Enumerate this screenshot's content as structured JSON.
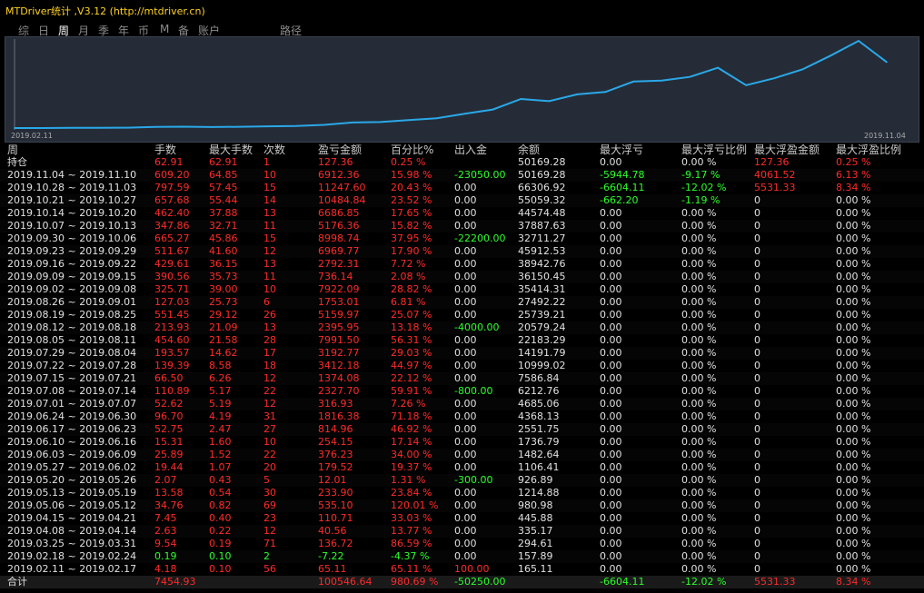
{
  "app": {
    "title": "MTDriver统计 ,V3.12 (http://mtdriver.cn)"
  },
  "tabs": [
    {
      "label": "综",
      "active": false
    },
    {
      "label": "日",
      "active": false
    },
    {
      "label": "周",
      "active": true
    },
    {
      "label": "月",
      "active": false
    },
    {
      "label": "季",
      "active": false
    },
    {
      "label": "年",
      "active": false
    },
    {
      "label": "币",
      "active": false
    },
    {
      "label": "M",
      "active": false
    },
    {
      "label": "备",
      "active": false
    },
    {
      "label": "账户",
      "active": false
    },
    {
      "label": "路径",
      "active": false
    }
  ],
  "colors": {
    "line": "#2aa8e8",
    "loss": "#ff2a2a",
    "gain": "#2aff2a",
    "neutral": "#e0e0e0",
    "title": "#ffd21e",
    "chart_bg": "#252c37"
  },
  "chart_data": {
    "type": "line",
    "x_start_label": "2019.02.11",
    "x_end_label": "2019.11.04",
    "series": [
      {
        "values": [
          165.11,
          157.89,
          294.61,
          335.17,
          445.88,
          980.98,
          1214.88,
          926.89,
          1106.41,
          1482.64,
          1736.79,
          2551.75,
          4368.13,
          4685.06,
          6212.76,
          7586.84,
          10999.02,
          14191.79,
          22183.29,
          20579.24,
          25739.21,
          27492.22,
          35414.31,
          36150.45,
          38942.76,
          45912.53,
          32711.27,
          37887.63,
          44574.48,
          55059.32,
          66306.92,
          50169.28
        ]
      }
    ]
  },
  "table": {
    "headers": [
      "周",
      "手数",
      "最大手数",
      "次数",
      "盈亏金额",
      "百分比%",
      "出入金",
      "余额",
      "最大浮亏",
      "最大浮亏比例",
      "最大浮盈金额",
      "最大浮盈比例"
    ],
    "rows": [
      [
        "持仓",
        "62.91",
        "62.91",
        "1",
        "127.36",
        "0.25 %",
        "",
        "50169.28",
        "0.00",
        "0.00 %",
        "127.36",
        "0.25 %"
      ],
      [
        "2019.11.04 ~ 2019.11.10",
        "609.20",
        "64.85",
        "10",
        "6912.36",
        "15.98 %",
        "-23050.00",
        "50169.28",
        "-5944.78",
        "-9.17 %",
        "4061.52",
        "6.13 %"
      ],
      [
        "2019.10.28 ~ 2019.11.03",
        "797.59",
        "57.45",
        "15",
        "11247.60",
        "20.43 %",
        "0.00",
        "66306.92",
        "-6604.11",
        "-12.02 %",
        "5531.33",
        "8.34 %"
      ],
      [
        "2019.10.21 ~ 2019.10.27",
        "657.68",
        "55.44",
        "14",
        "10484.84",
        "23.52 %",
        "0.00",
        "55059.32",
        "-662.20",
        "-1.19 %",
        "0",
        "0.00 %"
      ],
      [
        "2019.10.14 ~ 2019.10.20",
        "462.40",
        "37.88",
        "13",
        "6686.85",
        "17.65 %",
        "0.00",
        "44574.48",
        "0.00",
        "0.00 %",
        "0",
        "0.00 %"
      ],
      [
        "2019.10.07 ~ 2019.10.13",
        "347.86",
        "32.71",
        "11",
        "5176.36",
        "15.82 %",
        "0.00",
        "37887.63",
        "0.00",
        "0.00 %",
        "0",
        "0.00 %"
      ],
      [
        "2019.09.30 ~ 2019.10.06",
        "665.27",
        "45.86",
        "15",
        "8998.74",
        "37.95 %",
        "-22200.00",
        "32711.27",
        "0.00",
        "0.00 %",
        "0",
        "0.00 %"
      ],
      [
        "2019.09.23 ~ 2019.09.29",
        "511.67",
        "41.60",
        "12",
        "6969.77",
        "17.90 %",
        "0.00",
        "45912.53",
        "0.00",
        "0.00 %",
        "0",
        "0.00 %"
      ],
      [
        "2019.09.16 ~ 2019.09.22",
        "429.61",
        "36.15",
        "13",
        "2792.31",
        "7.72 %",
        "0.00",
        "38942.76",
        "0.00",
        "0.00 %",
        "0",
        "0.00 %"
      ],
      [
        "2019.09.09 ~ 2019.09.15",
        "390.56",
        "35.73",
        "11",
        "736.14",
        "2.08 %",
        "0.00",
        "36150.45",
        "0.00",
        "0.00 %",
        "0",
        "0.00 %"
      ],
      [
        "2019.09.02 ~ 2019.09.08",
        "325.71",
        "39.00",
        "10",
        "7922.09",
        "28.82 %",
        "0.00",
        "35414.31",
        "0.00",
        "0.00 %",
        "0",
        "0.00 %"
      ],
      [
        "2019.08.26 ~ 2019.09.01",
        "127.03",
        "25.73",
        "6",
        "1753.01",
        "6.81 %",
        "0.00",
        "27492.22",
        "0.00",
        "0.00 %",
        "0",
        "0.00 %"
      ],
      [
        "2019.08.19 ~ 2019.08.25",
        "551.45",
        "29.12",
        "26",
        "5159.97",
        "25.07 %",
        "0.00",
        "25739.21",
        "0.00",
        "0.00 %",
        "0",
        "0.00 %"
      ],
      [
        "2019.08.12 ~ 2019.08.18",
        "213.93",
        "21.09",
        "13",
        "2395.95",
        "13.18 %",
        "-4000.00",
        "20579.24",
        "0.00",
        "0.00 %",
        "0",
        "0.00 %"
      ],
      [
        "2019.08.05 ~ 2019.08.11",
        "454.60",
        "21.58",
        "28",
        "7991.50",
        "56.31 %",
        "0.00",
        "22183.29",
        "0.00",
        "0.00 %",
        "0",
        "0.00 %"
      ],
      [
        "2019.07.29 ~ 2019.08.04",
        "193.57",
        "14.62",
        "17",
        "3192.77",
        "29.03 %",
        "0.00",
        "14191.79",
        "0.00",
        "0.00 %",
        "0",
        "0.00 %"
      ],
      [
        "2019.07.22 ~ 2019.07.28",
        "139.39",
        "8.58",
        "18",
        "3412.18",
        "44.97 %",
        "0.00",
        "10999.02",
        "0.00",
        "0.00 %",
        "0",
        "0.00 %"
      ],
      [
        "2019.07.15 ~ 2019.07.21",
        "66.50",
        "6.26",
        "12",
        "1374.08",
        "22.12 %",
        "0.00",
        "7586.84",
        "0.00",
        "0.00 %",
        "0",
        "0.00 %"
      ],
      [
        "2019.07.08 ~ 2019.07.14",
        "110.89",
        "5.17",
        "22",
        "2327.70",
        "59.91 %",
        "-800.00",
        "6212.76",
        "0.00",
        "0.00 %",
        "0",
        "0.00 %"
      ],
      [
        "2019.07.01 ~ 2019.07.07",
        "52.62",
        "5.19",
        "12",
        "316.93",
        "7.26 %",
        "0.00",
        "4685.06",
        "0.00",
        "0.00 %",
        "0",
        "0.00 %"
      ],
      [
        "2019.06.24 ~ 2019.06.30",
        "96.70",
        "4.19",
        "31",
        "1816.38",
        "71.18 %",
        "0.00",
        "4368.13",
        "0.00",
        "0.00 %",
        "0",
        "0.00 %"
      ],
      [
        "2019.06.17 ~ 2019.06.23",
        "52.75",
        "2.47",
        "27",
        "814.96",
        "46.92 %",
        "0.00",
        "2551.75",
        "0.00",
        "0.00 %",
        "0",
        "0.00 %"
      ],
      [
        "2019.06.10 ~ 2019.06.16",
        "15.31",
        "1.60",
        "10",
        "254.15",
        "17.14 %",
        "0.00",
        "1736.79",
        "0.00",
        "0.00 %",
        "0",
        "0.00 %"
      ],
      [
        "2019.06.03 ~ 2019.06.09",
        "25.89",
        "1.52",
        "22",
        "376.23",
        "34.00 %",
        "0.00",
        "1482.64",
        "0.00",
        "0.00 %",
        "0",
        "0.00 %"
      ],
      [
        "2019.05.27 ~ 2019.06.02",
        "19.44",
        "1.07",
        "20",
        "179.52",
        "19.37 %",
        "0.00",
        "1106.41",
        "0.00",
        "0.00 %",
        "0",
        "0.00 %"
      ],
      [
        "2019.05.20 ~ 2019.05.26",
        "2.07",
        "0.43",
        "5",
        "12.01",
        "1.31 %",
        "-300.00",
        "926.89",
        "0.00",
        "0.00 %",
        "0",
        "0.00 %"
      ],
      [
        "2019.05.13 ~ 2019.05.19",
        "13.58",
        "0.54",
        "30",
        "233.90",
        "23.84 %",
        "0.00",
        "1214.88",
        "0.00",
        "0.00 %",
        "0",
        "0.00 %"
      ],
      [
        "2019.05.06 ~ 2019.05.12",
        "34.76",
        "0.82",
        "69",
        "535.10",
        "120.01 %",
        "0.00",
        "980.98",
        "0.00",
        "0.00 %",
        "0",
        "0.00 %"
      ],
      [
        "2019.04.15 ~ 2019.04.21",
        "7.45",
        "0.40",
        "23",
        "110.71",
        "33.03 %",
        "0.00",
        "445.88",
        "0.00",
        "0.00 %",
        "0",
        "0.00 %"
      ],
      [
        "2019.04.08 ~ 2019.04.14",
        "2.63",
        "0.22",
        "12",
        "40.56",
        "13.77 %",
        "0.00",
        "335.17",
        "0.00",
        "0.00 %",
        "0",
        "0.00 %"
      ],
      [
        "2019.03.25 ~ 2019.03.31",
        "9.54",
        "0.19",
        "71",
        "136.72",
        "86.59 %",
        "0.00",
        "294.61",
        "0.00",
        "0.00 %",
        "0",
        "0.00 %"
      ],
      [
        "2019.02.18 ~ 2019.02.24",
        "0.19",
        "0.10",
        "2",
        "-7.22",
        "-4.37 %",
        "0.00",
        "157.89",
        "0.00",
        "0.00 %",
        "0",
        "0.00 %"
      ],
      [
        "2019.02.11 ~ 2019.02.17",
        "4.18",
        "0.10",
        "56",
        "65.11",
        "65.11 %",
        "100.00",
        "165.11",
        "0.00",
        "0.00 %",
        "0",
        "0.00 %"
      ]
    ],
    "total": [
      "合计",
      "7454.93",
      "",
      "",
      "100546.64",
      "980.69 %",
      "-50250.00",
      "",
      "-6604.11",
      "-12.02 %",
      "5531.33",
      "8.34 %"
    ]
  }
}
